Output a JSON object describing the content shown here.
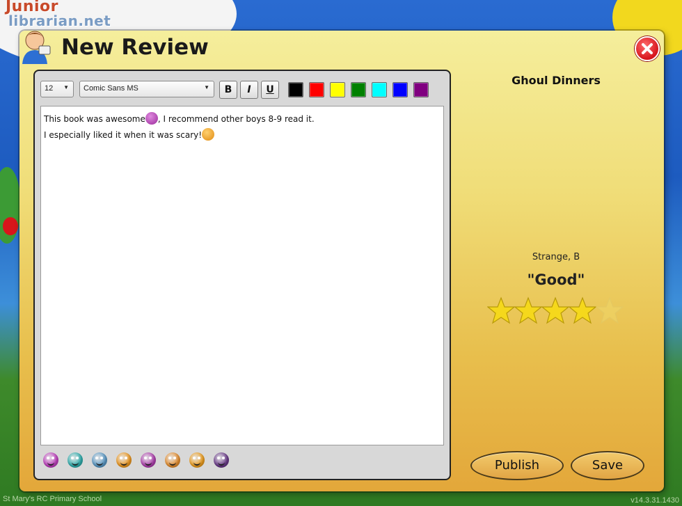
{
  "background": {
    "logo_line1": "Junior",
    "logo_line2": "librarian.net",
    "school": "St Mary's RC Primary School",
    "version": "v14.3.31.1430"
  },
  "dialog": {
    "title": "New Review",
    "close_icon": "close-icon"
  },
  "toolbar": {
    "font_size": "12",
    "font_family": "Comic Sans MS",
    "bold_label": "B",
    "italic_label": "I",
    "underline_label": "U",
    "colors": [
      "#000000",
      "#ff0000",
      "#ffff00",
      "#008000",
      "#00ffff",
      "#0000ff",
      "#800080"
    ]
  },
  "review": {
    "line1_before": "This book was awesome",
    "line1_after": ", I recommend other boys 8-9 read it.",
    "line2": "I especially liked it when it was scary!"
  },
  "emoji_bar": [
    {
      "name": "laughing-purple",
      "color": "#c040c0"
    },
    {
      "name": "smile-teal",
      "color": "#30b0b0"
    },
    {
      "name": "scared-blue",
      "color": "#5a9ac8"
    },
    {
      "name": "smile-orange",
      "color": "#f09a20"
    },
    {
      "name": "grin-purple",
      "color": "#b040b0"
    },
    {
      "name": "grin-orange",
      "color": "#e89030"
    },
    {
      "name": "surprised-orange",
      "color": "#f0a020"
    },
    {
      "name": "vampire-purple",
      "color": "#6a3a8a"
    }
  ],
  "book": {
    "title": "Ghoul Dinners",
    "author": "Strange, B",
    "rating_word": "\"Good\"",
    "rating": 4,
    "max_rating": 5
  },
  "actions": {
    "publish_label": "Publish",
    "save_label": "Save"
  }
}
